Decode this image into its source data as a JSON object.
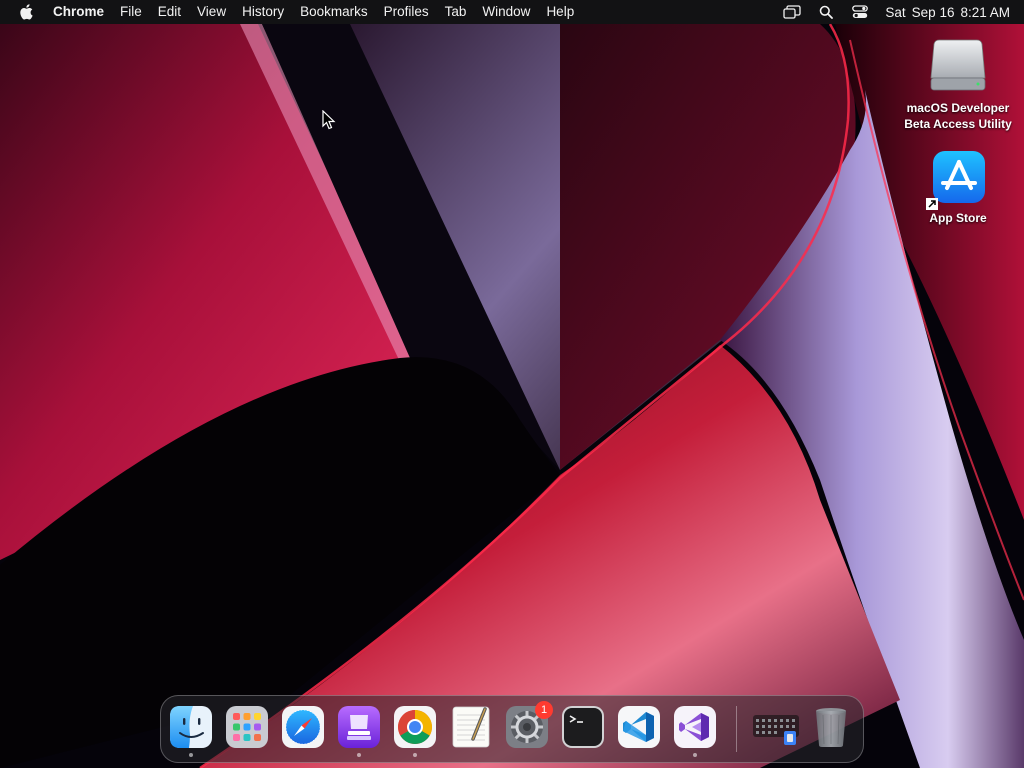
{
  "menubar": {
    "app_name": "Chrome",
    "items": [
      "File",
      "Edit",
      "View",
      "History",
      "Bookmarks",
      "Profiles",
      "Tab",
      "Window",
      "Help"
    ],
    "status_icons": [
      "screen-mirroring-icon",
      "spotlight-search-icon",
      "control-center-icon"
    ],
    "clock": {
      "day": "Sat",
      "date": "Sep 16",
      "time": "8:21 AM"
    }
  },
  "desktop": {
    "icons": [
      {
        "name": "drive-icon",
        "label_line1": "macOS Developer",
        "label_line2": "Beta Access Utility"
      },
      {
        "name": "app-store-icon",
        "label": "App Store"
      }
    ]
  },
  "dock": {
    "apps": [
      {
        "name": "finder-icon",
        "running": true
      },
      {
        "name": "launchpad-icon",
        "running": false
      },
      {
        "name": "safari-icon",
        "running": false
      },
      {
        "name": "xcode-icon",
        "running": true
      },
      {
        "name": "chrome-icon",
        "running": true
      },
      {
        "name": "textedit-icon",
        "running": false
      },
      {
        "name": "system-settings-icon",
        "running": false,
        "badge": "1"
      },
      {
        "name": "terminal-icon",
        "running": false
      },
      {
        "name": "vscode-icon",
        "running": false
      },
      {
        "name": "visual-studio-icon",
        "running": true
      },
      {
        "name": "downloads-stack-icon",
        "running": false
      },
      {
        "name": "trash-icon",
        "running": false
      }
    ]
  },
  "colors": {
    "wallpaper_crimson": "#8a0a2a",
    "wallpaper_lavender": "#a796d6",
    "dock_badge": "#ff3b30"
  }
}
